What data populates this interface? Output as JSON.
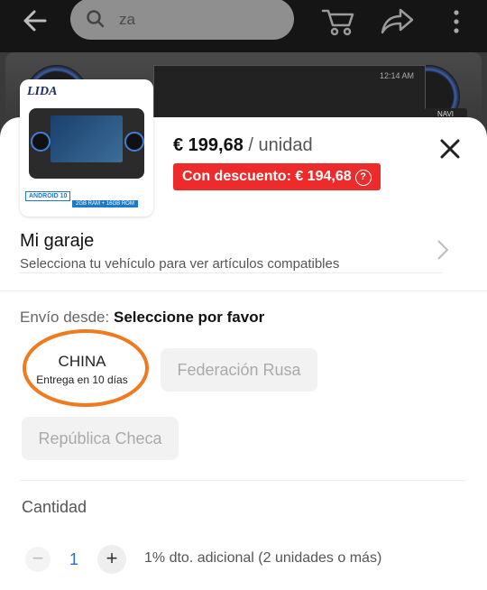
{
  "nav": {
    "search_value": "za",
    "icons": [
      "back-arrow-icon",
      "search-icon",
      "cart-icon",
      "share-icon",
      "more-icon"
    ]
  },
  "background": {
    "screen_time": "12:14 AM",
    "side_button": "NAVI"
  },
  "product": {
    "brand": "LIDA",
    "badge": "ANDROID 10",
    "spec": "2GB RAM + 16GB ROM",
    "price": "€ 199,68",
    "unit": "/ unidad",
    "discount_label": "Con descuento: € 194,68",
    "help_glyph": "?"
  },
  "garage": {
    "title": "Mi garaje",
    "subtitle": "Selecciona tu vehículo para ver artículos compatibles"
  },
  "shipping": {
    "label": "Envío desde:",
    "prompt": "Seleccione por favor",
    "options": [
      {
        "name": "CHINA",
        "sub": "Entrega en 10 días",
        "state": "available"
      },
      {
        "name": "Federación Rusa",
        "state": "disabled"
      },
      {
        "name": "República Checa",
        "state": "disabled"
      }
    ],
    "highlight_color": "#f07a1f"
  },
  "quantity": {
    "label": "Cantidad",
    "minus": "−",
    "value": "1",
    "plus": "+",
    "note": "1% dto. adicional (2 unidades o más)"
  },
  "colors": {
    "discount_bg": "#ee2b2b",
    "quantity_value": "#2a6fc0"
  }
}
